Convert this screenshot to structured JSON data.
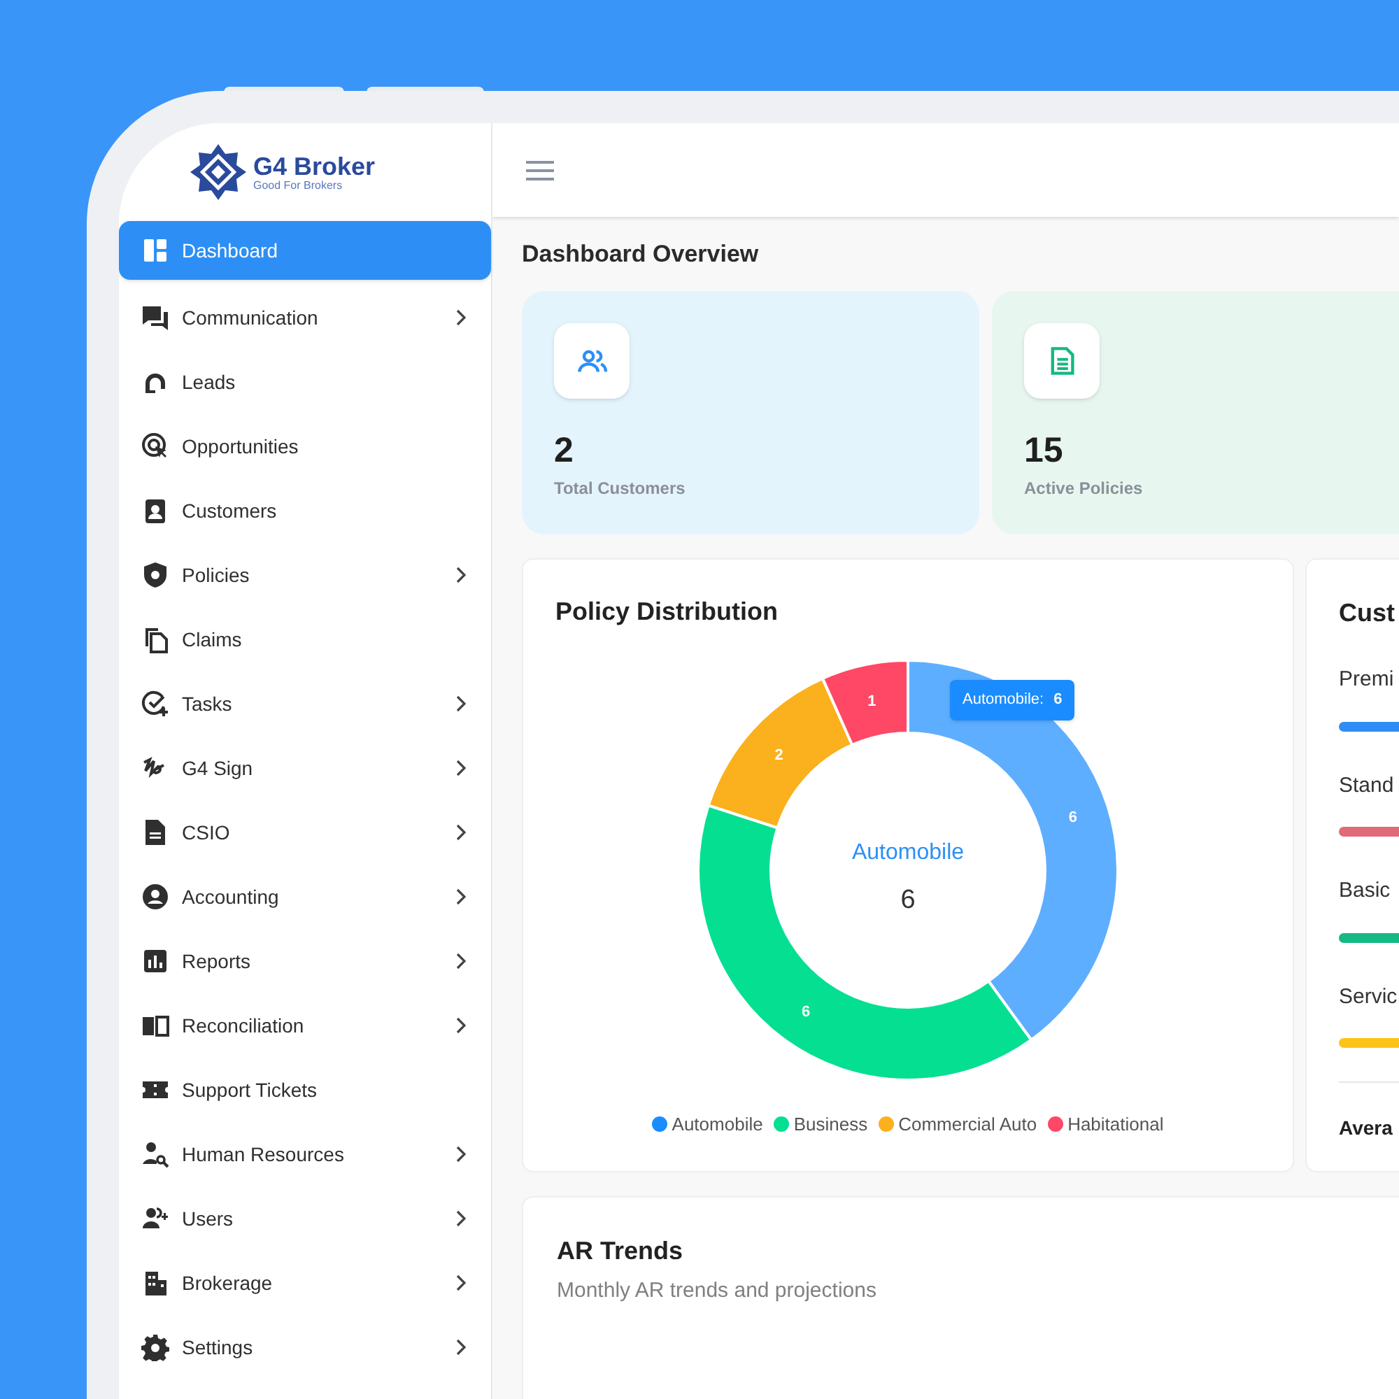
{
  "brand": {
    "name": "G4 Broker",
    "tagline": "Good For Brokers"
  },
  "sidebar": {
    "items": [
      {
        "label": "Dashboard",
        "selected": true,
        "has_submenu": false
      },
      {
        "label": "Communication",
        "selected": false,
        "has_submenu": true
      },
      {
        "label": "Leads",
        "selected": false,
        "has_submenu": false
      },
      {
        "label": "Opportunities",
        "selected": false,
        "has_submenu": false
      },
      {
        "label": "Customers",
        "selected": false,
        "has_submenu": false
      },
      {
        "label": "Policies",
        "selected": false,
        "has_submenu": true
      },
      {
        "label": "Claims",
        "selected": false,
        "has_submenu": false
      },
      {
        "label": "Tasks",
        "selected": false,
        "has_submenu": true
      },
      {
        "label": "G4 Sign",
        "selected": false,
        "has_submenu": true
      },
      {
        "label": "CSIO",
        "selected": false,
        "has_submenu": true
      },
      {
        "label": "Accounting",
        "selected": false,
        "has_submenu": true
      },
      {
        "label": "Reports",
        "selected": false,
        "has_submenu": true
      },
      {
        "label": "Reconciliation",
        "selected": false,
        "has_submenu": true
      },
      {
        "label": "Support Tickets",
        "selected": false,
        "has_submenu": false
      },
      {
        "label": "Human Resources",
        "selected": false,
        "has_submenu": true
      },
      {
        "label": "Users",
        "selected": false,
        "has_submenu": true
      },
      {
        "label": "Brokerage",
        "selected": false,
        "has_submenu": true
      },
      {
        "label": "Settings",
        "selected": false,
        "has_submenu": true
      }
    ]
  },
  "page_title": "Dashboard Overview",
  "stats": [
    {
      "value": "2",
      "label": "Total Customers",
      "kind": "customers"
    },
    {
      "value": "15",
      "label": "Active Policies",
      "kind": "policies"
    }
  ],
  "policy_distribution": {
    "title": "Policy Distribution",
    "center_label": "Automobile",
    "center_value": "6",
    "tooltip": {
      "label": "Automobile:",
      "value": "6"
    },
    "chart_data": {
      "type": "donut",
      "categories": [
        "Automobile",
        "Business",
        "Commercial Auto",
        "Habitational"
      ],
      "series": [
        {
          "values": [
            6,
            6,
            2,
            1
          ]
        }
      ],
      "data_labels": true
    },
    "legend": [
      {
        "color": "#1a8cff",
        "hovered": true
      },
      {
        "color": "#05df92",
        "hovered": false
      },
      {
        "color": "#fbb01d",
        "hovered": false
      },
      {
        "color": "#ff4766",
        "hovered": false
      }
    ]
  },
  "customer_panel": {
    "title": "Cust",
    "items": [
      {
        "label": "Premi",
        "color": "#2f8cf5"
      },
      {
        "label": "Stand",
        "color": "#e06a77"
      },
      {
        "label": "Basic",
        "color": "#16b883"
      },
      {
        "label": "Servic",
        "color": "#fcc419"
      }
    ],
    "footer": "Avera"
  },
  "ar_trends": {
    "title": "AR Trends",
    "subtitle": "Monthly AR trends and projections"
  }
}
